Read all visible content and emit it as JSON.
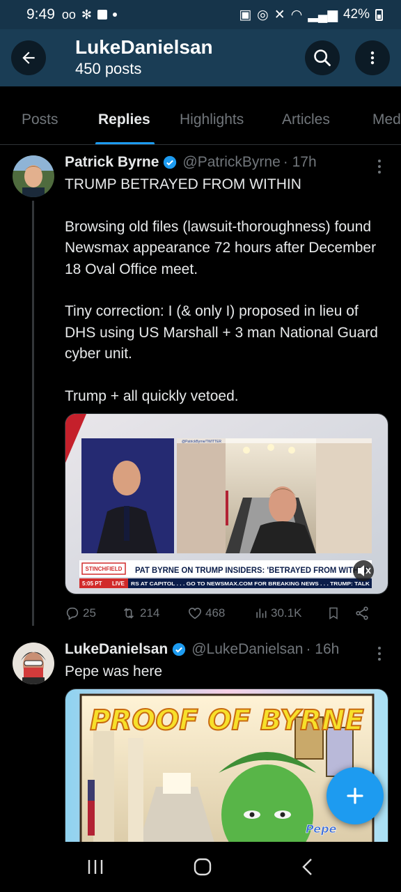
{
  "status_bar": {
    "time": "9:49",
    "battery": "42%"
  },
  "header": {
    "title": "LukeDanielsan",
    "subtitle": "450 posts"
  },
  "tabs": [
    {
      "label": "Posts"
    },
    {
      "label": "Replies"
    },
    {
      "label": "Highlights"
    },
    {
      "label": "Articles"
    },
    {
      "label": "Med"
    }
  ],
  "tweets": [
    {
      "name": "Patrick Byrne",
      "handle": "@PatrickByrne",
      "time": "· 17h",
      "text": "TRUMP BETRAYED FROM WITHIN\n\nBrowsing old files (lawsuit-thoroughness) found  Newsmax appearance 72 hours after December 18 Oval Office meet.\n\nTiny correction: I (& only I) proposed in lieu of DHS using US Marshall + 3 man National Guard cyber unit.\n\nTrump + all quickly vetoed.",
      "media": {
        "watermark": "@PatrickByrne/TWITTER",
        "show_logo": "STINCHFIELD",
        "headline": "PAT BYRNE ON TRUMP INSIDERS: 'BETRAYED FROM WITHIN'",
        "clock": "5:05 PT",
        "live": "LIVE",
        "ticker": "RS AT CAPITOL . . .     GO TO NEWSMAX.COM FOR BREAKING NEWS . . .     TRUMP: TALK"
      },
      "actions": {
        "replies": "25",
        "reposts": "214",
        "likes": "468",
        "views": "30.1K"
      }
    },
    {
      "name": "LukeDanielsan",
      "handle": "@LukeDanielsan",
      "time": "· 16h",
      "text": "Pepe was here",
      "media": {
        "graffiti": "PROOF OF BYRNE",
        "tag": "Pepe"
      }
    }
  ],
  "colors": {
    "accent": "#1d9bf0",
    "header_bg": "#1a3d55",
    "muted": "#71767b"
  },
  "icons": [
    "back-arrow-icon",
    "search-icon",
    "more-vertical-icon",
    "verified-badge-icon",
    "reply-icon",
    "repost-icon",
    "like-icon",
    "views-icon",
    "bookmark-icon",
    "share-icon",
    "compose-plus-icon"
  ]
}
